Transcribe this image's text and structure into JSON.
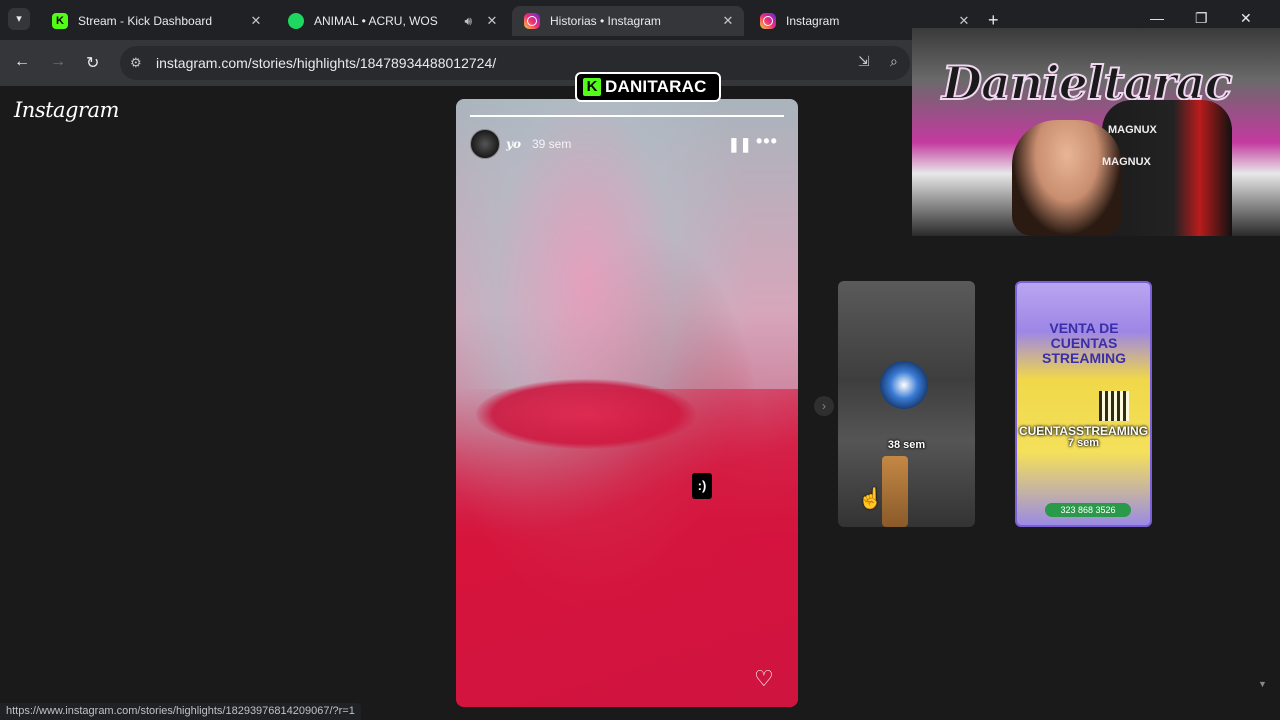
{
  "browser": {
    "tabs": [
      {
        "title": "Stream - Kick Dashboard",
        "icon": "kick-icon",
        "active": false
      },
      {
        "title": "ANIMAL • ACRU, WOS",
        "icon": "spotify-icon",
        "active": false,
        "audio": true
      },
      {
        "title": "Historias • Instagram",
        "icon": "instagram-icon",
        "active": true
      },
      {
        "title": "Instagram",
        "icon": "instagram-icon",
        "active": false
      }
    ],
    "url": "instagram.com/stories/highlights/18478934488012724/",
    "status_url": "https://www.instagram.com/stories/highlights/18293976814209067/?r=1"
  },
  "instagram": {
    "logo": "Instagram",
    "story": {
      "user": "yo",
      "time": "39 sem",
      "progress": 1.0,
      "sticker": ":)",
      "pause_icon": "pause-icon",
      "more_icon": "more-icon",
      "like_icon": "heart-icon"
    },
    "next_highlights": [
      {
        "name": "",
        "time": "38 sem"
      },
      {
        "name": "CUENTASSTREAMING",
        "time": "7 sem",
        "headline": "VENTA DE CUENTAS STREAMING",
        "phone": "323 868 3526"
      }
    ]
  },
  "overlay": {
    "channel": "DANITARAC",
    "graffiti": "Danieltarac",
    "chair_brand": "MAGNUX"
  },
  "colors": {
    "kick_green": "#53fc18",
    "page_bg": "#1a1a1a",
    "tab_active": "#35363a"
  }
}
